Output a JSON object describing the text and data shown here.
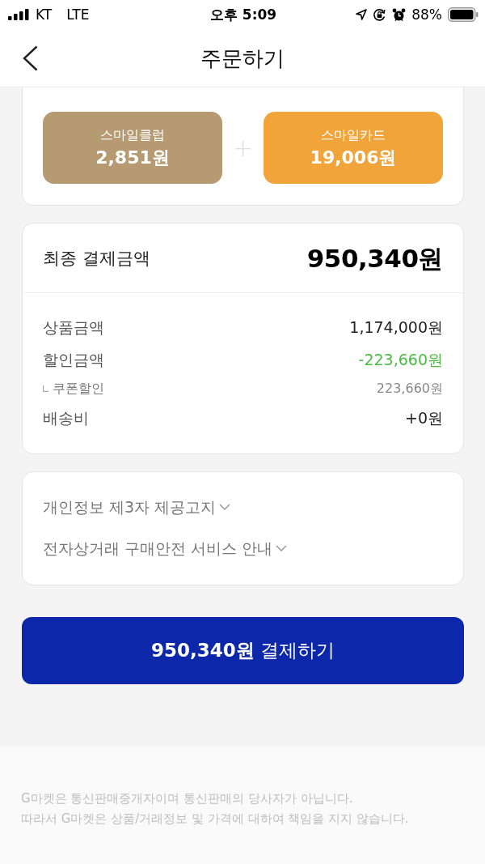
{
  "status_bar": {
    "carrier": "KT",
    "network": "LTE",
    "time": "오후 5:09",
    "battery": "88%"
  },
  "header": {
    "title": "주문하기"
  },
  "rewards": {
    "items": [
      {
        "label": "스마일클럽",
        "amount": "2,851원",
        "color": "#b59a72"
      },
      {
        "label": "스마일카드",
        "amount": "19,006원",
        "color": "#f1a43a"
      }
    ],
    "separator": "+"
  },
  "payment_summary": {
    "title": "최종 결제금액",
    "total": "950,340원",
    "rows": [
      {
        "kind": "main",
        "label": "상품금액",
        "value": "1,174,000원"
      },
      {
        "kind": "discount",
        "label": "할인금액",
        "value": "-223,660원"
      },
      {
        "kind": "sub",
        "label": "쿠폰할인",
        "value": "223,660원"
      },
      {
        "kind": "main",
        "label": "배송비",
        "value": "+0원"
      }
    ]
  },
  "notices": [
    {
      "label": "개인정보 제3자 제공고지",
      "expanded": false
    },
    {
      "label": "전자상거래 구매안전 서비스 안내",
      "expanded": false
    }
  ],
  "pay_button": {
    "label": "**950,340원** 결제하기"
  },
  "footer": {
    "lines": [
      "G마켓은 통신판매중개자이며 통신판매의 당사자가 아닙니다.",
      "따라서 G마켓은 상품/거래정보 및 가격에 대하여 책임을 지지 않습니다."
    ]
  }
}
